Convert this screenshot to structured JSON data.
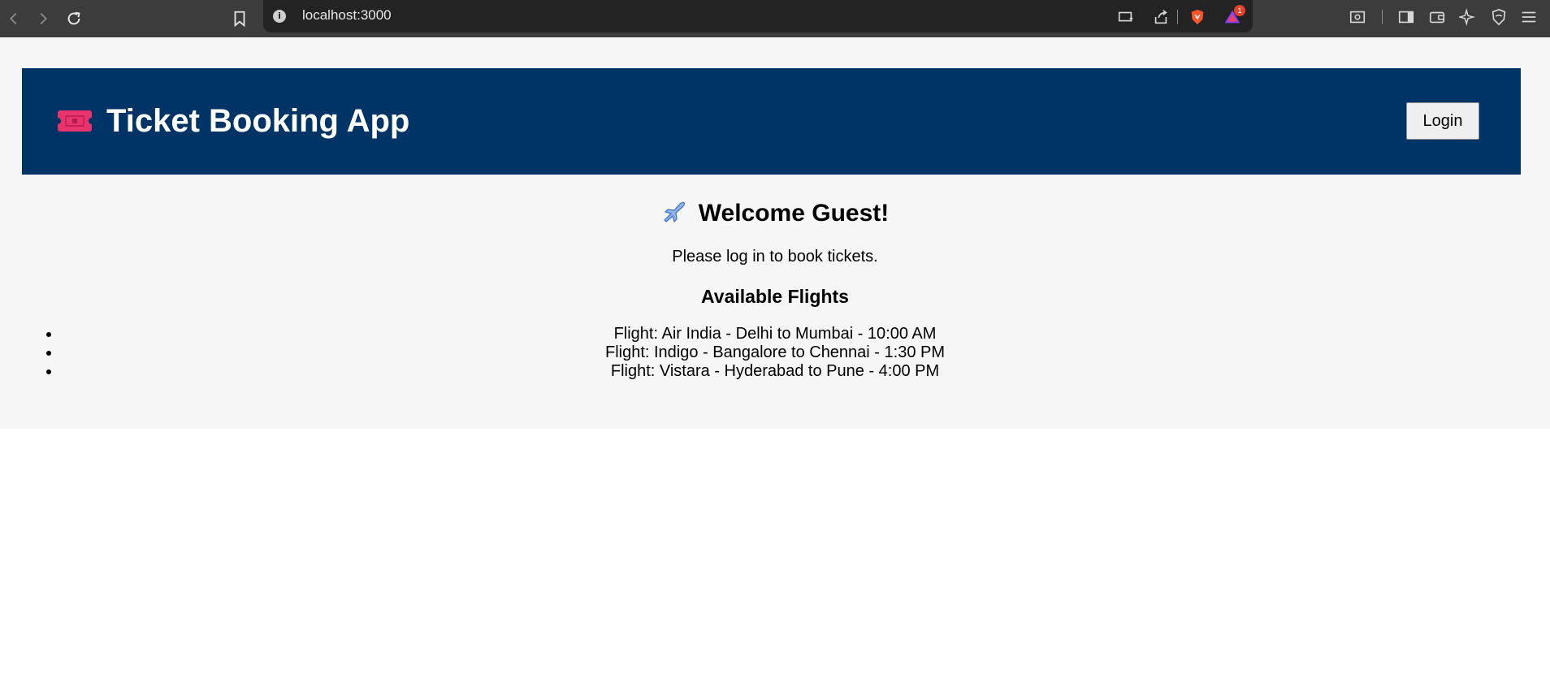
{
  "browser": {
    "url": "localhost:3000",
    "notification_count": "1"
  },
  "header": {
    "title": "Ticket Booking App",
    "logo_icon": "ticket-icon",
    "login_label": "Login",
    "background_color": "#003366"
  },
  "main": {
    "welcome_icon": "airplane-icon",
    "welcome_text": "Welcome Guest!",
    "subtitle": "Please log in to book tickets.",
    "flights_heading": "Available Flights",
    "flights": [
      "Flight: Air India - Delhi to Mumbai - 10:00 AM",
      "Flight: Indigo - Bangalore to Chennai - 1:30 PM",
      "Flight: Vistara - Hyderabad to Pune - 4:00 PM"
    ]
  }
}
